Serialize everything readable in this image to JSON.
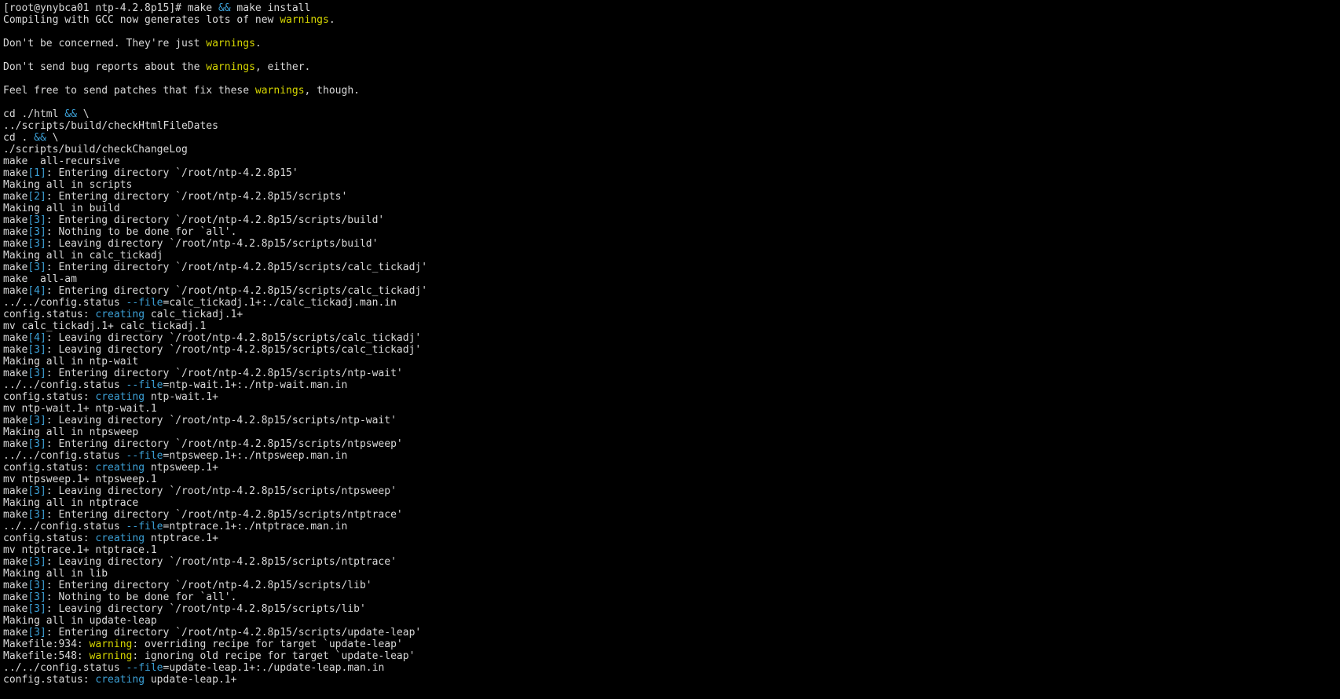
{
  "terminal": {
    "colors": {
      "background": "#000000",
      "text": "#d9d9d9",
      "highlight_blue": "#3ca0d6",
      "highlight_yellow": "#d6d600"
    },
    "lines": [
      {
        "segments": [
          {
            "t": "[root@ynybca01 ntp-4.2.8p15]# make "
          },
          {
            "t": "&&",
            "c": "kw"
          },
          {
            "t": " make install"
          }
        ]
      },
      {
        "segments": [
          {
            "t": "Compiling with GCC now generates lots of new "
          },
          {
            "t": "warnings",
            "c": "warn"
          },
          {
            "t": "."
          }
        ]
      },
      {
        "segments": []
      },
      {
        "segments": [
          {
            "t": "Don't be concerned. They're just "
          },
          {
            "t": "warnings",
            "c": "warn"
          },
          {
            "t": "."
          }
        ]
      },
      {
        "segments": []
      },
      {
        "segments": [
          {
            "t": "Don't send bug reports about the "
          },
          {
            "t": "warnings",
            "c": "warn"
          },
          {
            "t": ", either."
          }
        ]
      },
      {
        "segments": []
      },
      {
        "segments": [
          {
            "t": "Feel free to send patches that fix these "
          },
          {
            "t": "warnings",
            "c": "warn"
          },
          {
            "t": ", though."
          }
        ]
      },
      {
        "segments": []
      },
      {
        "segments": [
          {
            "t": "cd ./html "
          },
          {
            "t": "&&",
            "c": "kw"
          },
          {
            "t": " \\"
          }
        ]
      },
      {
        "segments": [
          {
            "t": "../scripts/build/checkHtmlFileDates"
          }
        ]
      },
      {
        "segments": [
          {
            "t": "cd . "
          },
          {
            "t": "&&",
            "c": "kw"
          },
          {
            "t": " \\"
          }
        ]
      },
      {
        "segments": [
          {
            "t": "./scripts/build/checkChangeLog"
          }
        ]
      },
      {
        "segments": [
          {
            "t": "make  all-recursive"
          }
        ]
      },
      {
        "segments": [
          {
            "t": "make"
          },
          {
            "t": "[1]",
            "c": "kw"
          },
          {
            "t": ": Entering directory `/root/ntp-4.2.8p15'"
          }
        ]
      },
      {
        "segments": [
          {
            "t": "Making all in scripts"
          }
        ]
      },
      {
        "segments": [
          {
            "t": "make"
          },
          {
            "t": "[2]",
            "c": "kw"
          },
          {
            "t": ": Entering directory `/root/ntp-4.2.8p15/scripts'"
          }
        ]
      },
      {
        "segments": [
          {
            "t": "Making all in build"
          }
        ]
      },
      {
        "segments": [
          {
            "t": "make"
          },
          {
            "t": "[3]",
            "c": "kw"
          },
          {
            "t": ": Entering directory `/root/ntp-4.2.8p15/scripts/build'"
          }
        ]
      },
      {
        "segments": [
          {
            "t": "make"
          },
          {
            "t": "[3]",
            "c": "kw"
          },
          {
            "t": ": Nothing to be done for `all'."
          }
        ]
      },
      {
        "segments": [
          {
            "t": "make"
          },
          {
            "t": "[3]",
            "c": "kw"
          },
          {
            "t": ": Leaving directory `/root/ntp-4.2.8p15/scripts/build'"
          }
        ]
      },
      {
        "segments": [
          {
            "t": "Making all in calc_tickadj"
          }
        ]
      },
      {
        "segments": [
          {
            "t": "make"
          },
          {
            "t": "[3]",
            "c": "kw"
          },
          {
            "t": ": Entering directory `/root/ntp-4.2.8p15/scripts/calc_tickadj'"
          }
        ]
      },
      {
        "segments": [
          {
            "t": "make  all-am"
          }
        ]
      },
      {
        "segments": [
          {
            "t": "make"
          },
          {
            "t": "[4]",
            "c": "kw"
          },
          {
            "t": ": Entering directory `/root/ntp-4.2.8p15/scripts/calc_tickadj'"
          }
        ]
      },
      {
        "segments": [
          {
            "t": "../../config.status "
          },
          {
            "t": "--file",
            "c": "kw"
          },
          {
            "t": "=calc_tickadj.1+:./calc_tickadj.man.in"
          }
        ]
      },
      {
        "segments": [
          {
            "t": "config.status: "
          },
          {
            "t": "creating",
            "c": "kw"
          },
          {
            "t": " calc_tickadj.1+"
          }
        ]
      },
      {
        "segments": [
          {
            "t": "mv calc_tickadj.1+ calc_tickadj.1"
          }
        ]
      },
      {
        "segments": [
          {
            "t": "make"
          },
          {
            "t": "[4]",
            "c": "kw"
          },
          {
            "t": ": Leaving directory `/root/ntp-4.2.8p15/scripts/calc_tickadj'"
          }
        ]
      },
      {
        "segments": [
          {
            "t": "make"
          },
          {
            "t": "[3]",
            "c": "kw"
          },
          {
            "t": ": Leaving directory `/root/ntp-4.2.8p15/scripts/calc_tickadj'"
          }
        ]
      },
      {
        "segments": [
          {
            "t": "Making all in ntp-wait"
          }
        ]
      },
      {
        "segments": [
          {
            "t": "make"
          },
          {
            "t": "[3]",
            "c": "kw"
          },
          {
            "t": ": Entering directory `/root/ntp-4.2.8p15/scripts/ntp-wait'"
          }
        ]
      },
      {
        "segments": [
          {
            "t": "../../config.status "
          },
          {
            "t": "--file",
            "c": "kw"
          },
          {
            "t": "=ntp-wait.1+:./ntp-wait.man.in"
          }
        ]
      },
      {
        "segments": [
          {
            "t": "config.status: "
          },
          {
            "t": "creating",
            "c": "kw"
          },
          {
            "t": " ntp-wait.1+"
          }
        ]
      },
      {
        "segments": [
          {
            "t": "mv ntp-wait.1+ ntp-wait.1"
          }
        ]
      },
      {
        "segments": [
          {
            "t": "make"
          },
          {
            "t": "[3]",
            "c": "kw"
          },
          {
            "t": ": Leaving directory `/root/ntp-4.2.8p15/scripts/ntp-wait'"
          }
        ]
      },
      {
        "segments": [
          {
            "t": "Making all in ntpsweep"
          }
        ]
      },
      {
        "segments": [
          {
            "t": "make"
          },
          {
            "t": "[3]",
            "c": "kw"
          },
          {
            "t": ": Entering directory `/root/ntp-4.2.8p15/scripts/ntpsweep'"
          }
        ]
      },
      {
        "segments": [
          {
            "t": "../../config.status "
          },
          {
            "t": "--file",
            "c": "kw"
          },
          {
            "t": "=ntpsweep.1+:./ntpsweep.man.in"
          }
        ]
      },
      {
        "segments": [
          {
            "t": "config.status: "
          },
          {
            "t": "creating",
            "c": "kw"
          },
          {
            "t": " ntpsweep.1+"
          }
        ]
      },
      {
        "segments": [
          {
            "t": "mv ntpsweep.1+ ntpsweep.1"
          }
        ]
      },
      {
        "segments": [
          {
            "t": "make"
          },
          {
            "t": "[3]",
            "c": "kw"
          },
          {
            "t": ": Leaving directory `/root/ntp-4.2.8p15/scripts/ntpsweep'"
          }
        ]
      },
      {
        "segments": [
          {
            "t": "Making all in ntptrace"
          }
        ]
      },
      {
        "segments": [
          {
            "t": "make"
          },
          {
            "t": "[3]",
            "c": "kw"
          },
          {
            "t": ": Entering directory `/root/ntp-4.2.8p15/scripts/ntptrace'"
          }
        ]
      },
      {
        "segments": [
          {
            "t": "../../config.status "
          },
          {
            "t": "--file",
            "c": "kw"
          },
          {
            "t": "=ntptrace.1+:./ntptrace.man.in"
          }
        ]
      },
      {
        "segments": [
          {
            "t": "config.status: "
          },
          {
            "t": "creating",
            "c": "kw"
          },
          {
            "t": " ntptrace.1+"
          }
        ]
      },
      {
        "segments": [
          {
            "t": "mv ntptrace.1+ ntptrace.1"
          }
        ]
      },
      {
        "segments": [
          {
            "t": "make"
          },
          {
            "t": "[3]",
            "c": "kw"
          },
          {
            "t": ": Leaving directory `/root/ntp-4.2.8p15/scripts/ntptrace'"
          }
        ]
      },
      {
        "segments": [
          {
            "t": "Making all in lib"
          }
        ]
      },
      {
        "segments": [
          {
            "t": "make"
          },
          {
            "t": "[3]",
            "c": "kw"
          },
          {
            "t": ": Entering directory `/root/ntp-4.2.8p15/scripts/lib'"
          }
        ]
      },
      {
        "segments": [
          {
            "t": "make"
          },
          {
            "t": "[3]",
            "c": "kw"
          },
          {
            "t": ": Nothing to be done for `all'."
          }
        ]
      },
      {
        "segments": [
          {
            "t": "make"
          },
          {
            "t": "[3]",
            "c": "kw"
          },
          {
            "t": ": Leaving directory `/root/ntp-4.2.8p15/scripts/lib'"
          }
        ]
      },
      {
        "segments": [
          {
            "t": "Making all in update-leap"
          }
        ]
      },
      {
        "segments": [
          {
            "t": "make"
          },
          {
            "t": "[3]",
            "c": "kw"
          },
          {
            "t": ": Entering directory `/root/ntp-4.2.8p15/scripts/update-leap'"
          }
        ]
      },
      {
        "segments": [
          {
            "t": "Makefile:934: "
          },
          {
            "t": "warning",
            "c": "warn"
          },
          {
            "t": ": overriding recipe for target `update-leap'"
          }
        ]
      },
      {
        "segments": [
          {
            "t": "Makefile:548: "
          },
          {
            "t": "warning",
            "c": "warn"
          },
          {
            "t": ": ignoring old recipe for target `update-leap'"
          }
        ]
      },
      {
        "segments": [
          {
            "t": "../../config.status "
          },
          {
            "t": "--file",
            "c": "kw"
          },
          {
            "t": "=update-leap.1+:./update-leap.man.in"
          }
        ]
      },
      {
        "segments": [
          {
            "t": "config.status: "
          },
          {
            "t": "creating",
            "c": "kw"
          },
          {
            "t": " update-leap.1+"
          }
        ]
      }
    ]
  }
}
